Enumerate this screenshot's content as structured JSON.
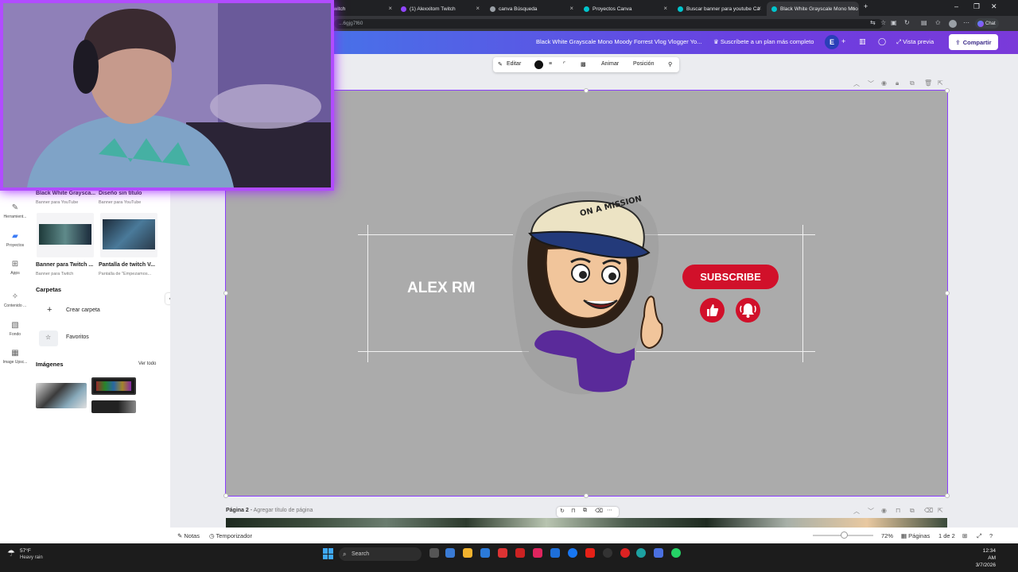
{
  "browser": {
    "tabs": [
      {
        "label": "Twitch",
        "active": false
      },
      {
        "label": "(1) Alexxitom  Twitch",
        "active": false
      },
      {
        "label": "canva  Búsqueda",
        "active": false
      },
      {
        "label": "Proyectos  Canva",
        "active": false
      },
      {
        "label": "Buscar banner para youtube  Ca",
        "active": false
      },
      {
        "label": "Black White Grayscale Mono Moo",
        "active": true
      }
    ],
    "url": "...6gjg7f60",
    "chat_label": "Chat"
  },
  "header": {
    "design_title": "Black White Grayscale Mono Moody Forrest Vlog Vlogger Yo...",
    "upgrade_label": "Suscríbete a un plan más completo",
    "avatar_letter": "E",
    "preview_label": "Vista previa",
    "share_label": "Compartir"
  },
  "leftnav": {
    "items": [
      {
        "label": "Herramient...",
        "icon": "tools-icon"
      },
      {
        "label": "Proyectos",
        "icon": "folder-icon",
        "active": true
      },
      {
        "label": "Apps",
        "icon": "apps-icon"
      },
      {
        "label": "Contenido ...",
        "icon": "magic-icon"
      },
      {
        "label": "Fondo",
        "icon": "background-icon"
      },
      {
        "label": "Image Upsc...",
        "icon": "upscale-icon"
      }
    ]
  },
  "panel": {
    "designs": [
      {
        "title": "Black White Graysca...",
        "subtitle": "Banner para YouTube"
      },
      {
        "title": "Diseño sin título",
        "subtitle": "Banner para YouTube"
      },
      {
        "title": "Banner para Twitch ...",
        "subtitle": "Banner para Twitch"
      },
      {
        "title": "Pantalla de twitch V...",
        "subtitle": "Pantalla de \"Empezamos..."
      }
    ],
    "folders_heading": "Carpetas",
    "create_folder": "Crear carpeta",
    "favorites": "Favoritos",
    "images_heading": "Imágenes",
    "see_all": "Ver todo"
  },
  "toolbar": {
    "edit": "Editar",
    "animate": "Animar",
    "position": "Posición"
  },
  "canvas": {
    "name_text": "ALEX RM",
    "subscribe_text": "SUBSCRIBE",
    "cap_text": "ON A MISSION",
    "background_color": "#ababab",
    "accent_red": "#d1102a"
  },
  "page2": {
    "label": "Página 2",
    "title_placeholder": "Agregar título de página"
  },
  "footer": {
    "notes": "Notas",
    "timer": "Temporizador",
    "zoom": "72%",
    "pages_label": "Páginas",
    "page_count": "1 de 2"
  },
  "taskbar": {
    "weather_temp": "57°F",
    "weather_desc": "Heavy rain",
    "search_placeholder": "Search",
    "time": "12:34 AM",
    "date": "3/7/2026"
  }
}
